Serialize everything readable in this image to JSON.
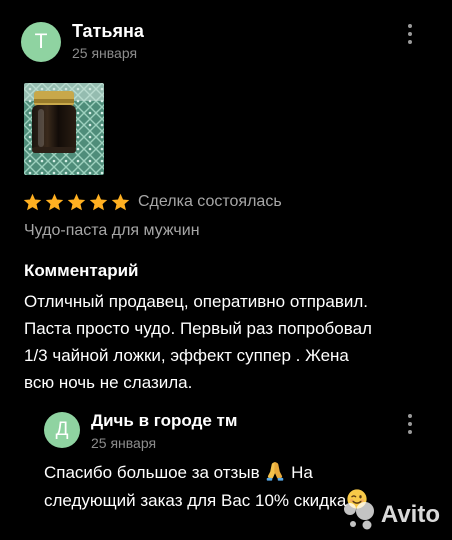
{
  "review": {
    "author": {
      "initial": "Т",
      "name": "Татьяна",
      "date": "25 января"
    },
    "rating": 5,
    "deal_status": "Сделка состоялась",
    "product": "Чудо-паста для мужчин",
    "comment_title": "Комментарий",
    "comment_lines": [
      "Отличный продавец, оперативно отправил.",
      "Паста просто чудо. Первый раз попробовал",
      "1/3 чайной ложки, эффект суппер . Жена",
      "всю ночь не слазила."
    ]
  },
  "reply": {
    "author": {
      "initial": "Д",
      "name": "Дичь в городе тм",
      "date": "25 января"
    },
    "lines": [
      "Спасибо большое за отзыв",
      "На",
      "следующий заказ для Вас 10% скидка"
    ],
    "emojis": [
      "folded-hands-emoji",
      "winking-face-emoji"
    ]
  },
  "watermark": {
    "text": "Avito"
  },
  "colors": {
    "background": "#000000",
    "avatar": "#8fd3a1",
    "star": "#ffb021",
    "muted_text": "#a6a6a6"
  }
}
